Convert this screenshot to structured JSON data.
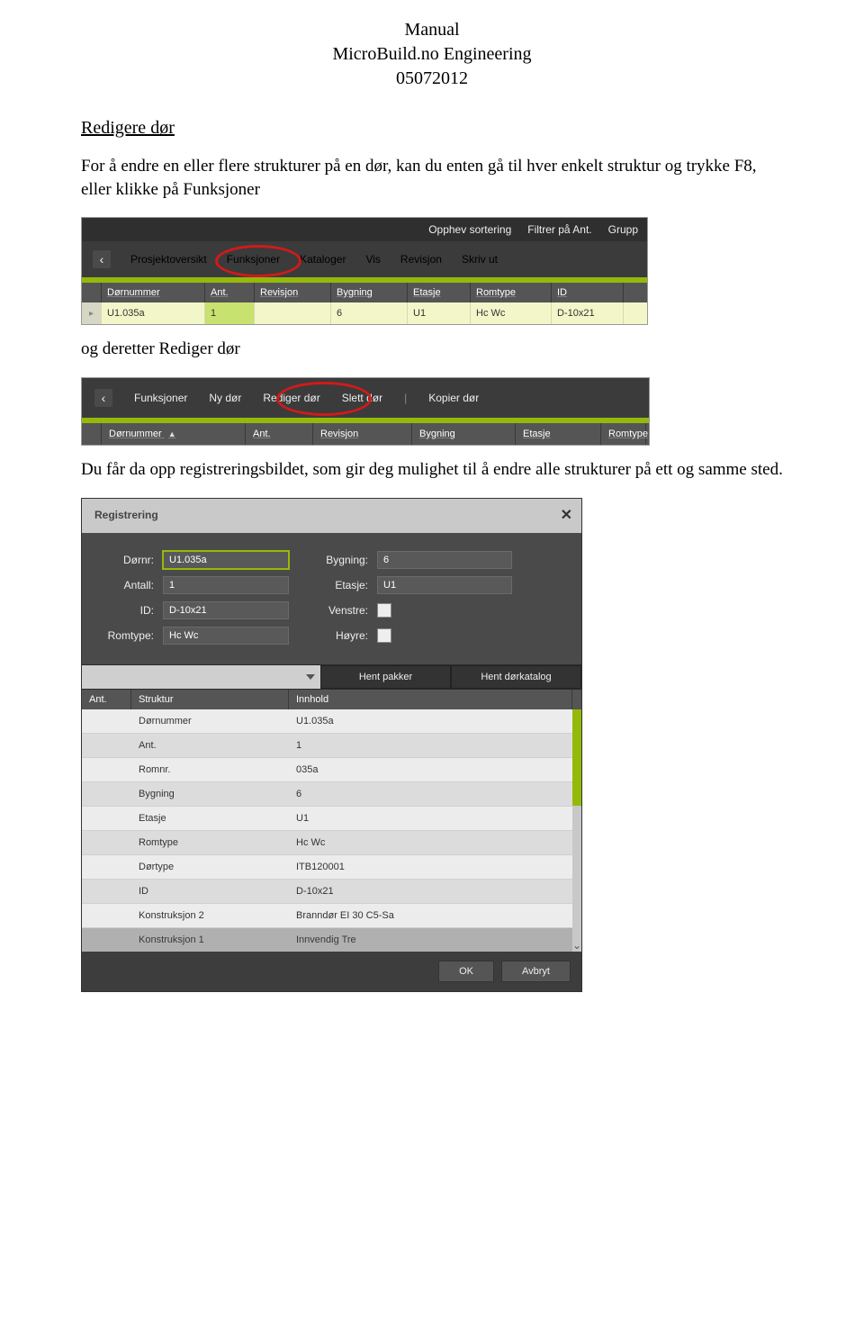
{
  "doc": {
    "title_line1": "Manual",
    "title_line2": "MicroBuild.no Engineering",
    "title_line3": "05072012",
    "section": "Redigere dør",
    "para1": "For å endre en eller flere strukturer på en dør, kan du enten gå til hver enkelt struktur og trykke F8, eller klikke på Funksjoner",
    "para2": "og deretter Rediger dør",
    "para3": "Du får da opp registreringsbildet, som gir deg mulighet til å endre alle strukturer på ett og samme sted."
  },
  "shot1": {
    "top": {
      "a": "Opphev sortering",
      "b": "Filtrer på Ant.",
      "c": "Grupp"
    },
    "menu": {
      "chev": "‹",
      "m1": "Prosjektoversikt",
      "m2": "Funksjoner",
      "m3": "Kataloger",
      "m4": "Vis",
      "m5": "Revisjon",
      "m6": "Skriv ut"
    },
    "headers": {
      "h1": "Dørnummer",
      "h2": "Ant.",
      "h3": "Revisjon",
      "h4": "Bygning",
      "h5": "Etasje",
      "h6": "Romtype",
      "h7": "ID"
    },
    "row": {
      "marker": "▸",
      "c1": "U1.035a",
      "c2": "1",
      "c3": "",
      "c4": "6",
      "c5": "U1",
      "c6": "Hc Wc",
      "c7": "D-10x21"
    }
  },
  "shot2": {
    "menu": {
      "chev": "‹",
      "m1": "Funksjoner",
      "m2": "Ny dør",
      "m3": "Rediger dør",
      "m4": "Slett dør",
      "sep": "|",
      "m5": "Kopier dør"
    },
    "headers": {
      "h1": "Dørnummer",
      "sorticon": "▲",
      "h2": "Ant.",
      "h3": "Revisjon",
      "h4": "Bygning",
      "h5": "Etasje",
      "h6": "Romtype"
    }
  },
  "shot3": {
    "title": "Registrering",
    "labels": {
      "dornr": "Dørnr:",
      "bygning": "Bygning:",
      "antall": "Antall:",
      "etasje": "Etasje:",
      "id": "ID:",
      "venstre": "Venstre:",
      "romtype": "Romtype:",
      "hoyre": "Høyre:"
    },
    "values": {
      "dornr": "U1.035a",
      "bygning": "6",
      "antall": "1",
      "etasje": "U1",
      "id": "D-10x21",
      "romtype": "Hc Wc"
    },
    "buttons": {
      "hent_pakker": "Hent pakker",
      "hent_dorkatalog": "Hent dørkatalog",
      "ok": "OK",
      "avbryt": "Avbryt"
    },
    "table_head": {
      "ant": "Ant.",
      "struktur": "Struktur",
      "innhold": "Innhold"
    },
    "rows": [
      {
        "s": "Dørnummer",
        "i": "U1.035a"
      },
      {
        "s": "Ant.",
        "i": "1"
      },
      {
        "s": "Romnr.",
        "i": "035a"
      },
      {
        "s": "Bygning",
        "i": "6"
      },
      {
        "s": "Etasje",
        "i": "U1"
      },
      {
        "s": "Romtype",
        "i": "Hc Wc"
      },
      {
        "s": "Dørtype",
        "i": "ITB120001"
      },
      {
        "s": "ID",
        "i": "D-10x21"
      },
      {
        "s": "Konstruksjon 2",
        "i": "Branndør EI 30 C5-Sa"
      },
      {
        "s": "Konstruksjon 1",
        "i": "Innvendig Tre"
      }
    ]
  }
}
